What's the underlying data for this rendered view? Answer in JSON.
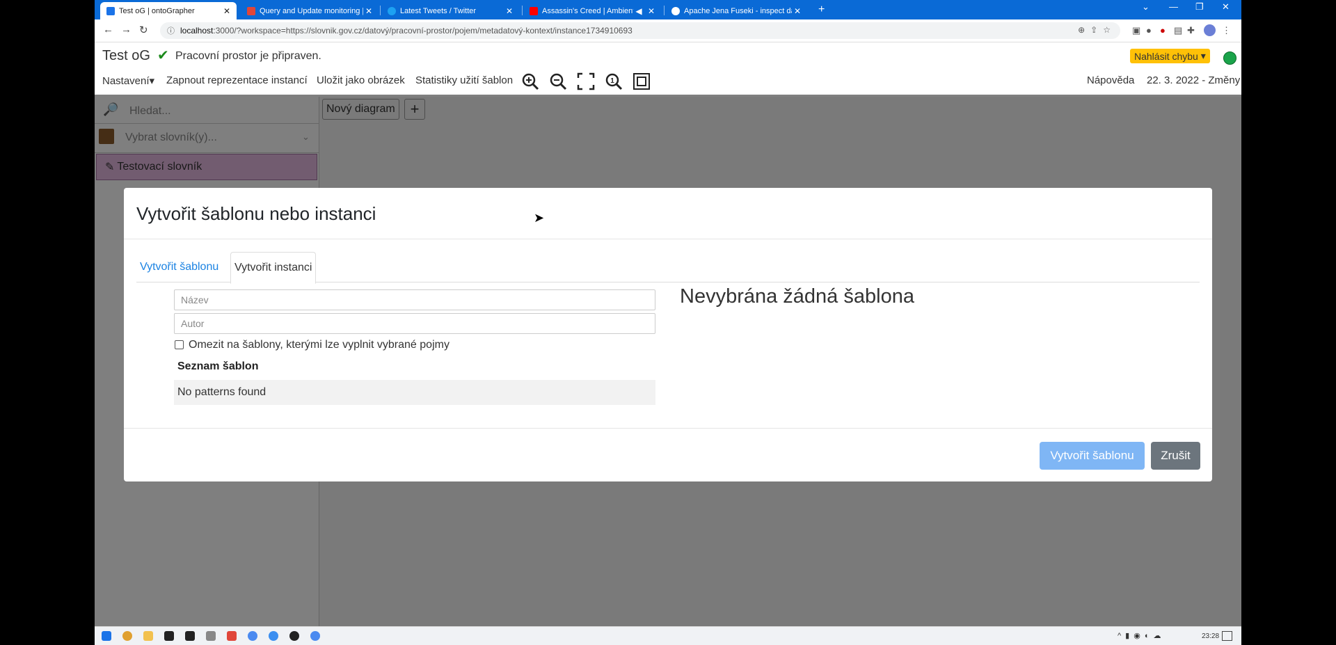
{
  "browser": {
    "tabs": [
      {
        "title": "Test oG | ontoGrapher",
        "active": true,
        "color": "#1a73e8"
      },
      {
        "title": "Query and Update monitoring | ",
        "active": false,
        "color": "#e0463a"
      },
      {
        "title": "Latest Tweets / Twitter",
        "active": false,
        "color": "#1da1f2"
      },
      {
        "title": "Assassin's Creed | Ambient S",
        "active": false,
        "color": "#ff0000"
      },
      {
        "title": "Apache Jena Fuseki - inspect dat",
        "active": false,
        "color": "#ffffff"
      }
    ],
    "url_host": "localhost",
    "url_rest": ":3000/?workspace=https://slovnik.gov.cz/datový/pracovní-prostor/pojem/metadatový-kontext/instance1734910693"
  },
  "app": {
    "title": "Test oG",
    "status": "Pracovní prostor je připraven.",
    "report_bug": "Nahlásit chybu",
    "menu": {
      "settings": "Nastavení",
      "toggle_instances": "Zapnout reprezentace instancí",
      "save_image": "Uložit jako obrázek",
      "stats": "Statistiky užití šablon"
    },
    "help": "Nápověda",
    "changes": "22. 3. 2022 - Změny"
  },
  "sidebar": {
    "search_placeholder": "Hledat...",
    "vocab_placeholder": "Vybrat slovník(y)...",
    "vocab_item": "Testovací slovník"
  },
  "canvas": {
    "diagram_tab": "Nový diagram",
    "add_label": "+"
  },
  "modal": {
    "title": "Vytvořit šablonu nebo instanci",
    "tab_template": "Vytvořit šablonu",
    "tab_instance": "Vytvořit instanci",
    "name_placeholder": "Název",
    "author_placeholder": "Autor",
    "filter_label": "Omezit na šablony, kterými lze vyplnit vybrané pojmy",
    "list_heading": "Seznam šablon",
    "list_empty": "No patterns found",
    "no_selection": "Nevybrána žádná šablona",
    "create_button": "Vytvořit šablonu",
    "cancel_button": "Zrušit"
  },
  "taskbar": {
    "time": "23:28"
  }
}
